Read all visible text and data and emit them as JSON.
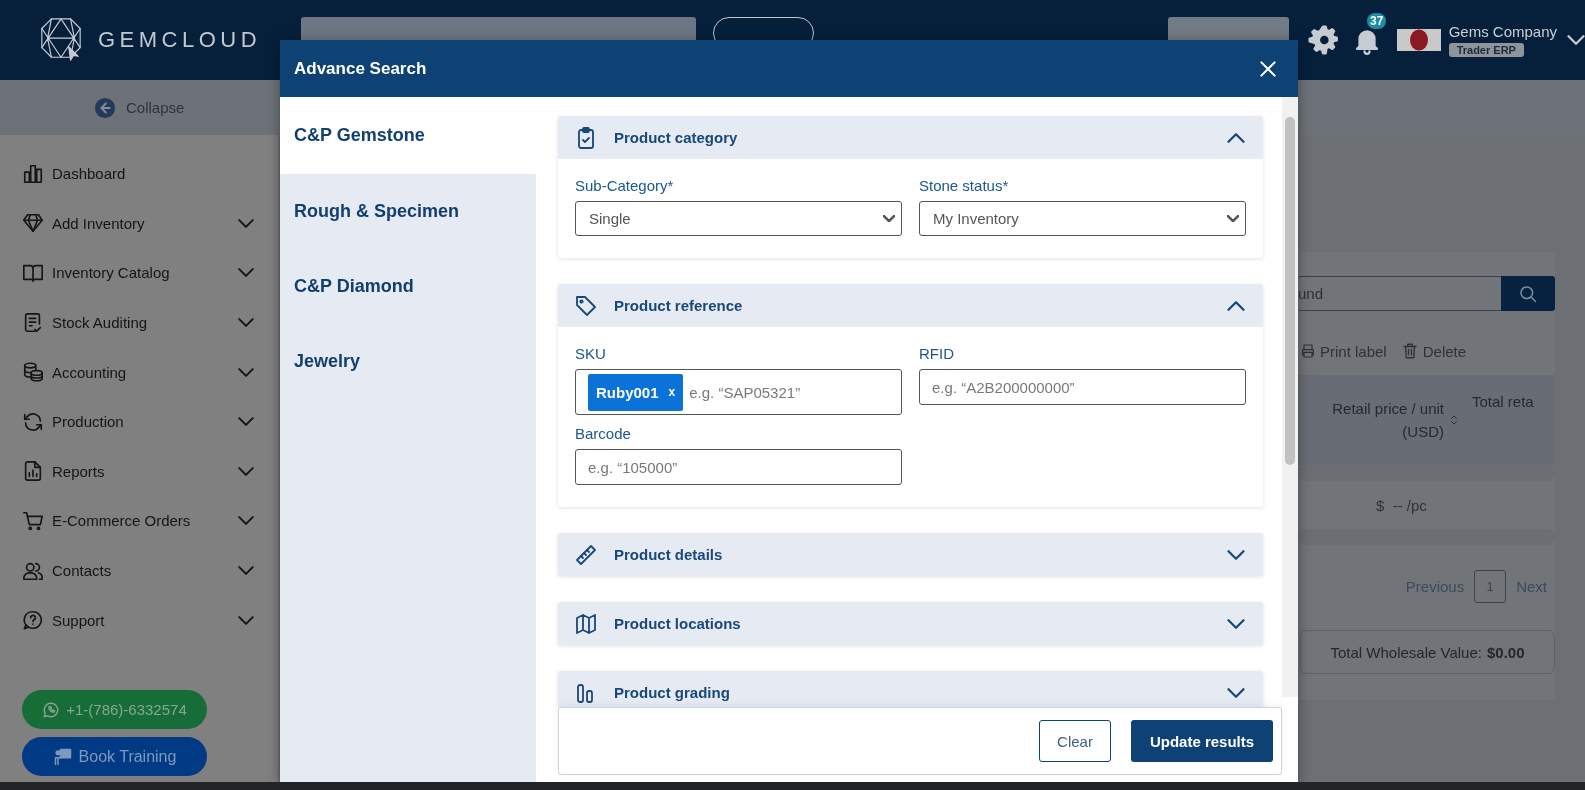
{
  "app_header": {
    "logo": "GEMCLOUD",
    "notification_count": "37",
    "company": "Gems Company",
    "plan": "Trader ERP"
  },
  "sidebar": {
    "collapse": "Collapse",
    "items": [
      {
        "label": "Dashboard",
        "expandable": false
      },
      {
        "label": "Add Inventory",
        "expandable": true
      },
      {
        "label": "Inventory Catalog",
        "expandable": true
      },
      {
        "label": "Stock Auditing",
        "expandable": true
      },
      {
        "label": "Accounting",
        "expandable": true
      },
      {
        "label": "Production",
        "expandable": true
      },
      {
        "label": "Reports",
        "expandable": true
      },
      {
        "label": "E-Commerce Orders",
        "expandable": true
      },
      {
        "label": "Contacts",
        "expandable": true
      },
      {
        "label": "Support",
        "expandable": true
      }
    ],
    "phone": "+1-(786)-6332574",
    "training": "Book Training"
  },
  "page": {
    "search_value": "und",
    "actions": [
      "Print label",
      "Delete"
    ],
    "columns": [
      "Retail price / unit (USD)",
      "Total reta"
    ],
    "cell": "$  -- /pc",
    "pagination": {
      "previous": "Previous",
      "page": "1",
      "next": "Next"
    },
    "total": {
      "label": "Total Wholesale Value:",
      "value": "$0.00"
    }
  },
  "modal": {
    "title": "Advance Search",
    "categories": [
      {
        "label": "C&P Gemstone",
        "selected": true
      },
      {
        "label": "Rough & Specimen",
        "selected": false
      },
      {
        "label": "C&P Diamond",
        "selected": false
      },
      {
        "label": "Jewelry",
        "selected": false
      }
    ],
    "sections": [
      {
        "title": "Product category",
        "expanded": true,
        "fields": [
          {
            "kind": "select",
            "label": "Sub-Category*",
            "value": "Single"
          },
          {
            "kind": "select",
            "label": "Stone status*",
            "value": "My Inventory"
          }
        ]
      },
      {
        "title": "Product reference",
        "expanded": true,
        "fields": [
          {
            "kind": "tags",
            "label": "SKU",
            "tags": [
              {
                "label": "Ruby001",
                "remove": "x"
              }
            ],
            "placeholder": "e.g. “SAP05321”"
          },
          {
            "kind": "text",
            "label": "RFID",
            "placeholder": "e.g. “A2B200000000”"
          },
          {
            "kind": "text",
            "label": "Barcode",
            "placeholder": "e.g. “105000”"
          }
        ]
      },
      {
        "title": "Product details",
        "expanded": false
      },
      {
        "title": "Product locations",
        "expanded": false
      },
      {
        "title": "Product grading",
        "expanded": false
      }
    ],
    "buttons": {
      "clear": "Clear",
      "update": "Update results"
    }
  }
}
